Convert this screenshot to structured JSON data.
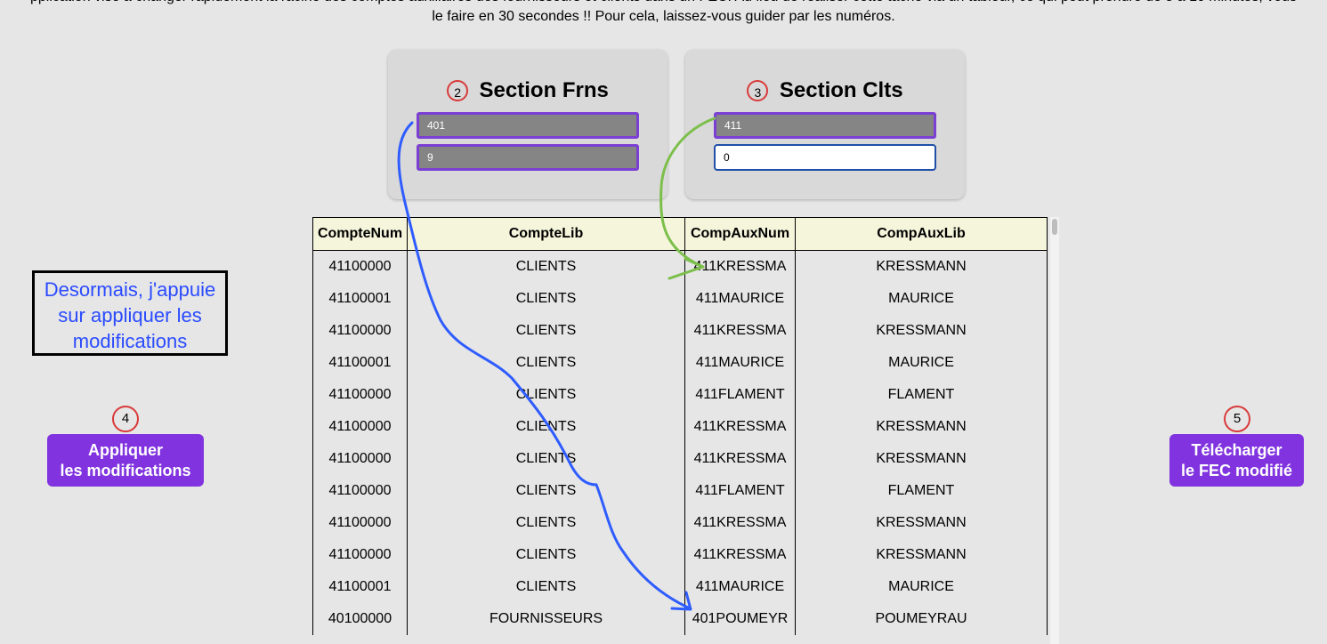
{
  "intro": {
    "line1": "pplication vise à changer rapidement la racine des comptes auxiliaires des fournisseurs et clients dans un FEC. Au lieu de réaliser cette tâche via un tableur, ce qui peut prendre de 5 à 10 minutes, vous",
    "line2": "le faire en 30 secondes !! Pour cela, laissez-vous guider par les numéros."
  },
  "section_frns": {
    "step": "2",
    "title": "Section Frns",
    "field1_value": "401",
    "field2_value": "9"
  },
  "section_clts": {
    "step": "3",
    "title": "Section Clts",
    "field1_value": "411",
    "field2_value": "0"
  },
  "note": {
    "line1": "Desormais, j'appuie",
    "line2": "sur appliquer les",
    "line3": "modifications"
  },
  "apply": {
    "step": "4",
    "line1": "Appliquer",
    "line2": "les modifications"
  },
  "download": {
    "step": "5",
    "line1": "Télécharger",
    "line2": "le FEC modifié"
  },
  "table": {
    "headers": [
      "CompteNum",
      "CompteLib",
      "CompAuxNum",
      "CompAuxLib"
    ],
    "rows": [
      [
        "41100000",
        "CLIENTS",
        "411KRESSMA",
        "KRESSMANN"
      ],
      [
        "41100001",
        "CLIENTS",
        "411MAURICE",
        "MAURICE"
      ],
      [
        "41100000",
        "CLIENTS",
        "411KRESSMA",
        "KRESSMANN"
      ],
      [
        "41100001",
        "CLIENTS",
        "411MAURICE",
        "MAURICE"
      ],
      [
        "41100000",
        "CLIENTS",
        "411FLAMENT",
        "FLAMENT"
      ],
      [
        "41100000",
        "CLIENTS",
        "411KRESSMA",
        "KRESSMANN"
      ],
      [
        "41100000",
        "CLIENTS",
        "411KRESSMA",
        "KRESSMANN"
      ],
      [
        "41100000",
        "CLIENTS",
        "411FLAMENT",
        "FLAMENT"
      ],
      [
        "41100000",
        "CLIENTS",
        "411KRESSMA",
        "KRESSMANN"
      ],
      [
        "41100000",
        "CLIENTS",
        "411KRESSMA",
        "KRESSMANN"
      ],
      [
        "41100001",
        "CLIENTS",
        "411MAURICE",
        "MAURICE"
      ],
      [
        "40100000",
        "FOURNISSEURS",
        "401POUMEYR",
        "POUMEYRAU"
      ]
    ]
  },
  "colors": {
    "accent_purple": "#8033df",
    "step_circle_red": "#d93a3a",
    "header_bg": "#f5f5dc",
    "note_text_blue": "#2a4bff",
    "arrow_blue": "#2f5cff",
    "arrow_green": "#7cbf4a"
  }
}
